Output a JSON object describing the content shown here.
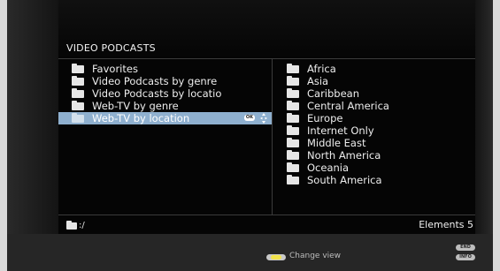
{
  "header": {
    "title": "VIDEO PODCASTS"
  },
  "left_list": {
    "items": [
      {
        "label": "Favorites"
      },
      {
        "label": "Video Podcasts by genre"
      },
      {
        "label": "Video Podcasts by locatio"
      },
      {
        "label": "Web-TV by genre"
      },
      {
        "label": "Web-TV by location",
        "selected": true,
        "ok_badge": "OK"
      }
    ]
  },
  "right_list": {
    "items": [
      {
        "label": "Africa"
      },
      {
        "label": "Asia"
      },
      {
        "label": "Caribbean"
      },
      {
        "label": "Central America"
      },
      {
        "label": "Europe"
      },
      {
        "label": "Internet Only"
      },
      {
        "label": "Middle East"
      },
      {
        "label": "North America"
      },
      {
        "label": "Oceania"
      },
      {
        "label": "South America"
      }
    ]
  },
  "status": {
    "path": ":/",
    "elements": "Elements 5"
  },
  "footer": {
    "change_view_label": "Change view",
    "end_key": "END",
    "info_key": "INFO"
  },
  "colors": {
    "selection": "#8fb0cf",
    "yellow_key": "#f1e24a",
    "background": "#050505"
  },
  "icons": {
    "folder": "folder-icon",
    "navigation_arrows": "arrows-icon",
    "yellow_button": "yellow-key-icon"
  }
}
